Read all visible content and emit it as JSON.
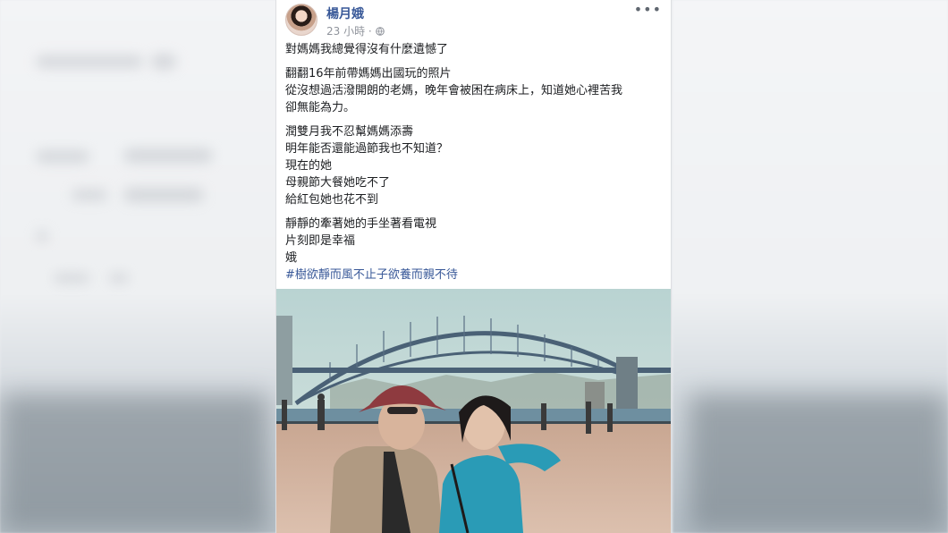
{
  "post": {
    "author": "楊月娥",
    "time": "23 小時 ·",
    "paragraphs": [
      [
        "對媽媽我總覺得沒有什麼遺憾了"
      ],
      [
        "翻翻16年前帶媽媽出國玩的照片",
        "從沒想過活潑開朗的老媽，晚年會被困在病床上，知道她心裡苦我",
        "卻無能為力。"
      ],
      [
        "潤雙月我不忍幫媽媽添壽",
        "明年能否還能過節我也不知道？",
        "現在的她",
        "母親節大餐她吃不了",
        "給紅包她也花不到"
      ],
      [
        "靜靜的牽著她的手坐著看電視",
        "片刻即是幸福",
        "娥"
      ]
    ],
    "hashtag": "#樹欲靜而風不止子欲養而親不待"
  },
  "icons": {
    "globe": "globe-icon",
    "more": "more-options-icon"
  },
  "colors": {
    "link": "#385898",
    "text": "#1c1e21",
    "meta": "#90949c"
  }
}
